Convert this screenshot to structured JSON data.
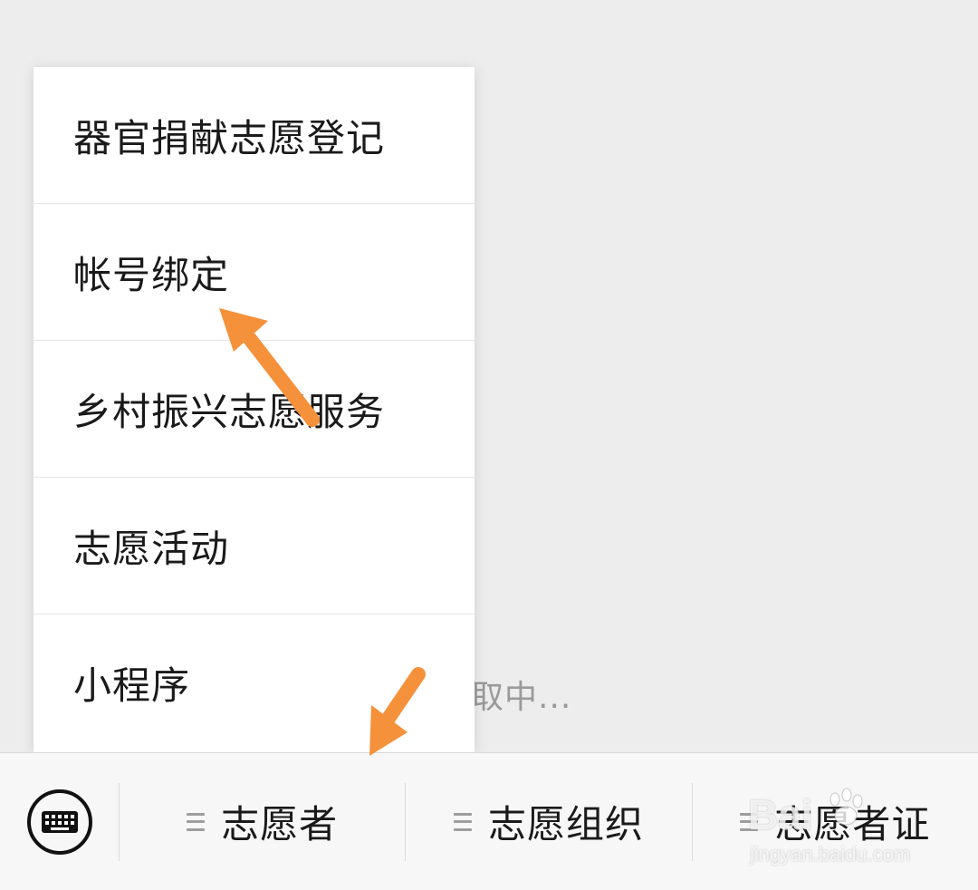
{
  "menu": {
    "items": [
      {
        "label": "器官捐献志愿登记"
      },
      {
        "label": "帐号绑定"
      },
      {
        "label": "乡村振兴志愿服务"
      },
      {
        "label": "志愿活动"
      },
      {
        "label": "小程序"
      }
    ]
  },
  "loading_text": "取中...",
  "bottom_bar": {
    "keyboard_icon": "keyboard-icon",
    "tabs": [
      {
        "label": "志愿者",
        "icon": "menu-lines-icon"
      },
      {
        "label": "志愿组织",
        "icon": "menu-lines-icon"
      },
      {
        "label": "志愿者证",
        "icon": "menu-lines-icon"
      }
    ]
  },
  "annotation_color": "#f5913a",
  "watermark": {
    "brand": "Bai",
    "url": "jingyan.baidu.com"
  }
}
